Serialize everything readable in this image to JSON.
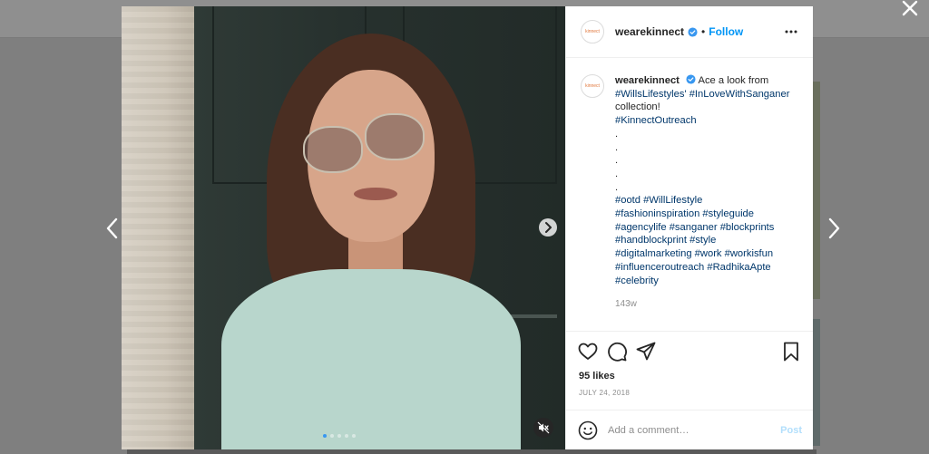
{
  "post": {
    "username": "wearekinnect",
    "avatar_mark": "kinnect",
    "follow_separator": "•",
    "follow_label": "Follow",
    "caption": {
      "username": "wearekinnect",
      "line1": "Ace a look from",
      "line2": "#WillsLifestyles' #InLoveWithSanganer",
      "line3": "collection!",
      "line4": "#KinnectOutreach",
      "dot_lines": [
        ".",
        ".",
        ".",
        ".",
        "."
      ],
      "hashtag_lines": [
        "#ootd #WillLifestyle",
        "#fashioninspiration #styleguide",
        "#agencylife #sanganer #blockprints",
        "#handblockprint #style",
        "#digitalmarketing #work #workisfun",
        "#influenceroutreach #RadhikaApte",
        "#celebrity"
      ]
    },
    "time_ago": "143w",
    "likes": "95 likes",
    "date": "JULY 24, 2018",
    "comment_placeholder": "Add a comment…",
    "post_label": "Post"
  },
  "media": {
    "carousel_count": 5,
    "active_index": 0
  },
  "icons": {
    "close": "close-icon",
    "prev": "chevron-left-icon",
    "next": "chevron-right-icon",
    "like": "heart-icon",
    "comment": "comment-icon",
    "share": "share-icon",
    "save": "bookmark-icon",
    "more": "more-options-icon",
    "emoji": "emoji-icon",
    "mute": "muted-speaker-icon"
  },
  "colors": {
    "link": "#00376b",
    "follow": "#0095f6",
    "verified": "#3897f0",
    "post_disabled": "#b2dffc"
  }
}
